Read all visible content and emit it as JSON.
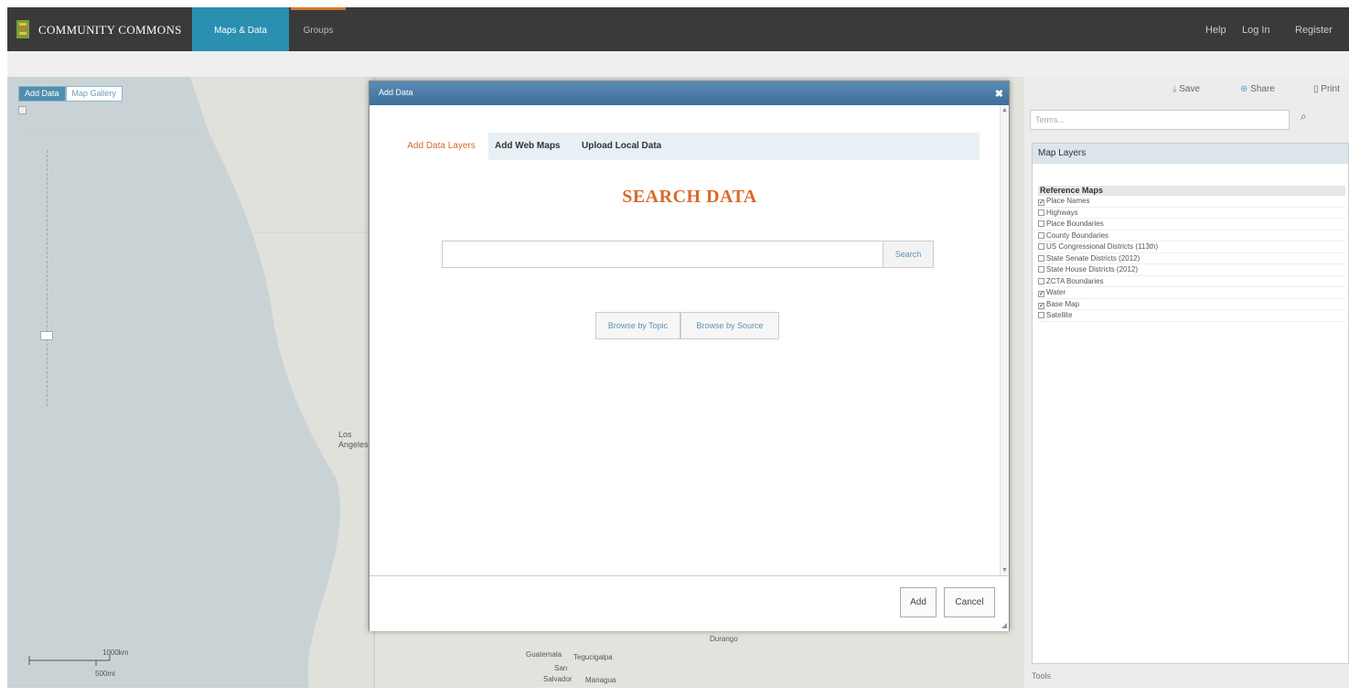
{
  "nav": {
    "brand": "COMMUNITY COMMONS",
    "tabs": [
      "Maps & Data",
      "Groups"
    ],
    "right_links": [
      "Help",
      "Log In",
      "Register"
    ]
  },
  "map": {
    "tabs": [
      "Add Data",
      "Map Gallery"
    ],
    "city_labels": [
      "Los",
      "Angeles"
    ],
    "scale_top": "1000km",
    "scale_bottom": "500mi",
    "below_labels": [
      "Durango",
      "Guatemala",
      "Tegucigalpa",
      "San",
      "Salvador",
      "Managua"
    ]
  },
  "right_panel": {
    "toolbar": [
      "Save",
      "Share",
      "Print"
    ],
    "search_placeholder": "Terms...",
    "layers_title": "Map Layers",
    "group_title": "Reference Maps",
    "layers": [
      {
        "label": "Place Names",
        "checked": true
      },
      {
        "label": "Highways",
        "checked": false
      },
      {
        "label": "Place Boundaries",
        "checked": false
      },
      {
        "label": "County Boundaries",
        "checked": false
      },
      {
        "label": "US Congressional Districts (113th)",
        "checked": false
      },
      {
        "label": "State Senate Districts (2012)",
        "checked": false
      },
      {
        "label": "State House Districts (2012)",
        "checked": false
      },
      {
        "label": "ZCTA Boundaries",
        "checked": false
      },
      {
        "label": "Water",
        "checked": true
      },
      {
        "label": "Base Map",
        "checked": true
      },
      {
        "label": "Satellite",
        "checked": false
      }
    ],
    "tools_label": "Tools"
  },
  "modal": {
    "title": "Add Data",
    "close_glyph": "✖",
    "tabs": [
      "Add Data Layers",
      "Add Web Maps",
      "Upload Local Data"
    ],
    "heading": "SEARCH DATA",
    "search_button": "Search",
    "browse_topic": "Browse by Topic",
    "browse_source": "Browse by Source",
    "add_button": "Add",
    "cancel_button": "Cancel"
  },
  "colors": {
    "accent_orange": "#d86a2a",
    "nav_active": "#2b8fb0",
    "modal_header": "#4a7ca6"
  }
}
